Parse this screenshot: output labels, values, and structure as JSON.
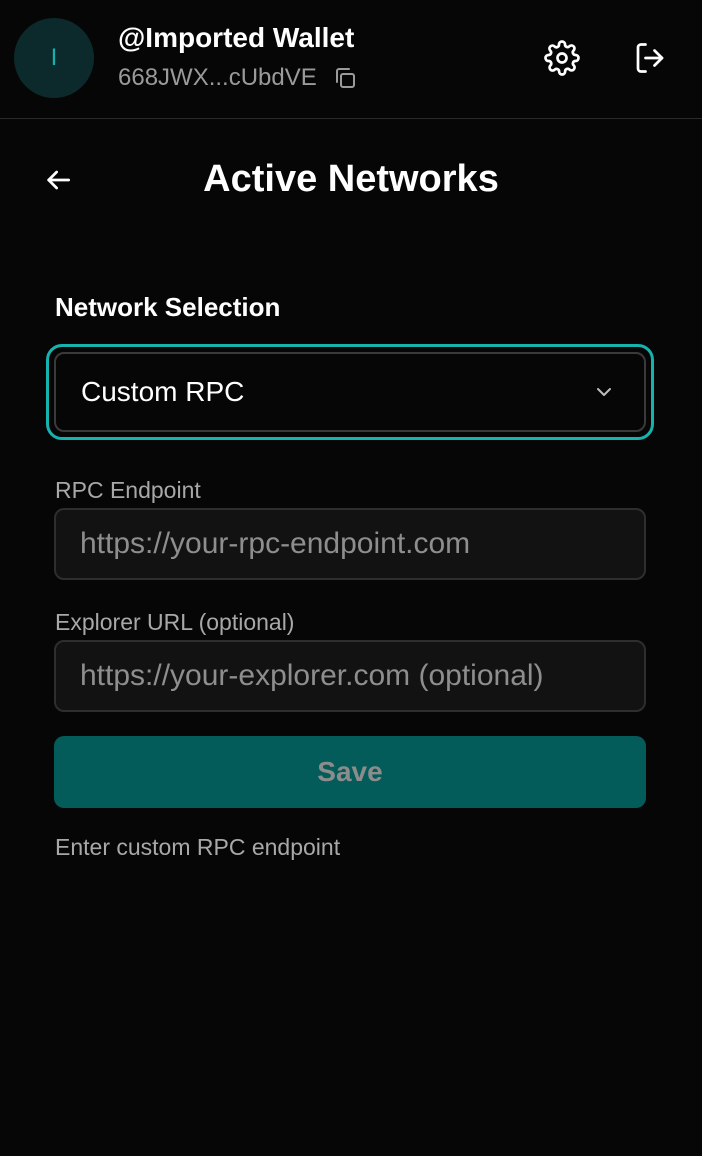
{
  "header": {
    "avatar_initial": "I",
    "wallet_name": "@Imported Wallet",
    "wallet_address": "668JWX...cUbdVE",
    "icons": [
      "copy-icon",
      "gear-icon",
      "logout-icon"
    ]
  },
  "page": {
    "title": "Active Networks",
    "back_icon": "arrow-left-icon"
  },
  "network_selection": {
    "label": "Network Selection",
    "selected": "Custom RPC"
  },
  "rpc_endpoint": {
    "label": "RPC Endpoint",
    "value": "",
    "placeholder": "https://your-rpc-endpoint.com"
  },
  "explorer_url": {
    "label": "Explorer URL (optional)",
    "value": "",
    "placeholder": "https://your-explorer.com (optional)"
  },
  "save_button": {
    "label": "Save"
  },
  "hint": "Enter custom RPC endpoint",
  "colors": {
    "accent": "#16b2ae",
    "save_button_bg": "#035c5a",
    "background": "#060606"
  }
}
